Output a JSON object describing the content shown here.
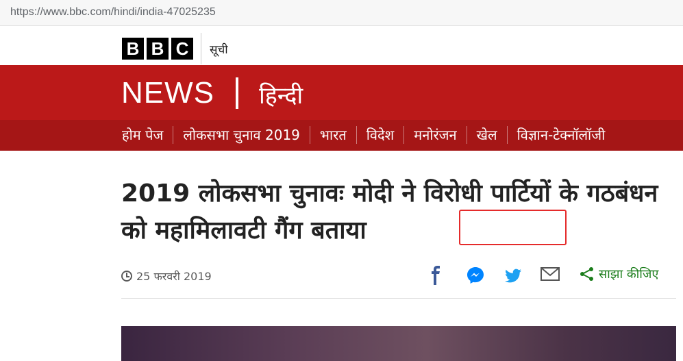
{
  "browser": {
    "url": "https://www.bbc.com/hindi/india-47025235"
  },
  "header": {
    "logo_letters": [
      "B",
      "B",
      "C"
    ],
    "menu_label": "सूची"
  },
  "brand": {
    "news": "NEWS",
    "language": "हिन्दी",
    "color": "#bb1919"
  },
  "nav": {
    "items": [
      "होम पेज",
      "लोकसभा चुनाव 2019",
      "भारत",
      "विदेश",
      "मनोरंजन",
      "खेल",
      "विज्ञान-टेक्नॉलॉजी"
    ]
  },
  "article": {
    "title": "2019 लोकसभा चुनावः मोदी ने विरोधी पार्टियों के गठबंधन को महामिलावटी गैंग बताया",
    "date": "25 फरवरी 2019",
    "share_label": "साझा कीजिए"
  },
  "share_icons": [
    "facebook-icon",
    "messenger-icon",
    "twitter-icon",
    "email-icon",
    "share-icon"
  ]
}
